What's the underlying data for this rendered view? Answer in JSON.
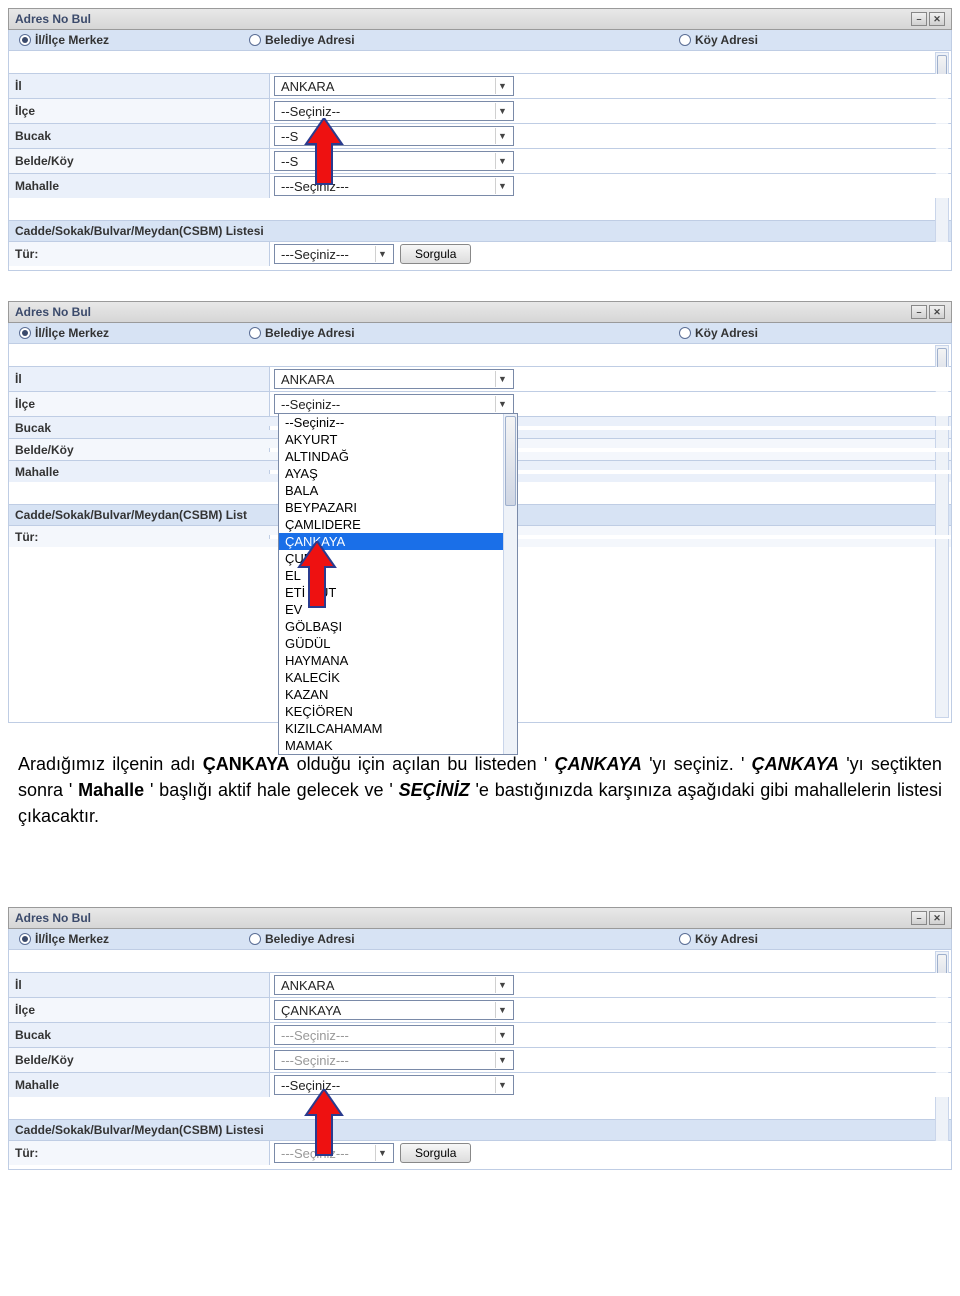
{
  "window": {
    "title": "Adres No Bul"
  },
  "tabs": {
    "merkez": "İl/İlçe Merkez",
    "belediye": "Belediye Adresi",
    "koy": "Köy Adresi"
  },
  "labels": {
    "il": "İl",
    "ilce": "İlçe",
    "bucak": "Bucak",
    "belde": "Belde/Köy",
    "mahalle": "Mahalle",
    "csbm": "Cadde/Sokak/Bulvar/Meydan(CSBM) Listesi",
    "csbm_short": "Cadde/Sokak/Bulvar/Meydan(CSBM) List",
    "tur": "Tür:"
  },
  "values": {
    "ankara": "ANKARA",
    "seciniz2": "--Seçiniz--",
    "seciniz3": "---Seçiniz---",
    "seciniz_s": "--S",
    "cankaya": "ÇANKAYA"
  },
  "button": {
    "sorgula": "Sorgula"
  },
  "dropdown": {
    "header": "--Seçiniz--",
    "items": [
      "--Seçiniz--",
      "AKYURT",
      "ALTINDAĞ",
      "AYAŞ",
      "BALA",
      "BEYPAZARI",
      "ÇAMLIDERE",
      "ÇANKAYA",
      "ÇUB",
      "EL",
      "ETİ        GUT",
      "EV",
      "GÖLBAŞI",
      "GÜDÜL",
      "HAYMANA",
      "KALECİK",
      "KAZAN",
      "KEÇİÖREN",
      "KIZILCAHAMAM",
      "MAMAK"
    ],
    "selected_index": 7
  },
  "para": {
    "t1": "Aradığımız ilçenin adı ",
    "b1": "ÇANKAYA",
    "t2": " olduğu için açılan bu listeden '",
    "bi1": "ÇANKAYA",
    "t3": "'yı seçiniz. '",
    "bi2": "ÇANKAYA",
    "t4": "'yı seçtikten sonra '",
    "b2": "Mahalle",
    "t5": "' başlığı aktif hale gelecek ve '",
    "bi3": "SEÇİNİZ",
    "t6": "'e bastığınızda karşınıza aşağıdaki gibi mahallelerin listesi çıkacaktır."
  }
}
